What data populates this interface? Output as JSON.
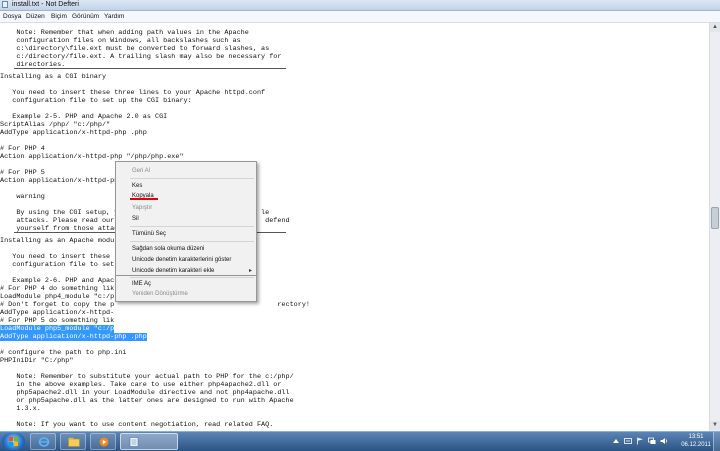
{
  "window": {
    "title": "install.txt - Not Defteri"
  },
  "menu": [
    "Dosya",
    "Düzen",
    "Biçim",
    "Görünüm",
    "Yardım"
  ],
  "document": {
    "lines": [
      "    Note: Remember that when adding path values in the Apache",
      "    configuration files on Windows, all backslashes such as",
      "    c:\\directory\\file.ext must be converted to forward slashes, as",
      "    c:/directory/file.ext. A trailing slash may also be necessary for",
      "    directories.",
      "",
      "Installing as a CGI binary",
      "",
      "   You need to insert these three lines to your Apache httpd.conf",
      "   configuration file to set up the CGI binary:",
      "",
      "   Example 2-5. PHP and Apache 2.0 as CGI",
      "ScriptAlias /php/ \"c:/php/\"",
      "AddType application/x-httpd-php .php",
      "",
      "# For PHP 4",
      "Action application/x-httpd-php \"/php/php.exe\"",
      "",
      "# For PHP 5",
      "Action application/x-httpd-php \"/php/php-cgi.exe\"",
      "",
      "    warning",
      "",
      "    By using the CGI setup, y                                   le",
      "    attacks. Please read our                                     defend",
      "    yourself from those attac",
      "",
      "",
      "Installing as an Apache modu",
      "",
      "   You need to insert these",
      "   configuration file to set",
      "",
      "   Example 2-6. PHP and Apac",
      "# For PHP 4 do something lik",
      "LoadModule php4_module \"c:/p",
      "# Don't forget to copy the p                                        rectory!",
      "AddType application/x-httpd-",
      "",
      "# For PHP 5 do something lik",
      "",
      "",
      "",
      "# configure the path to php.ini",
      "PHPIniDir \"C:/php\"",
      "",
      "    Note: Remember to substitute your actual path to PHP for the c:/php/",
      "    in the above examples. Take care to use either php4apache2.dll or",
      "    php5apache2.dll in your LoadModule directive and not php4apache.dll",
      "    or php5apache.dll as the latter ones are designed to run with Apache",
      "    1.3.x.",
      "",
      "    Note: If you want to use content negotiation, read related FAQ.",
      "",
      "    Warning",
      "",
      "    Don't mix up your installation with DLL files from different PHP",
      "    versions. You have the only choice to use the DLL's and extensions that",
      "    ship with your downloaded PHP version."
    ],
    "selected_lines": [
      "LoadModule php5_module \"c:/p",
      "AddType application/x-httpd-php .php"
    ]
  },
  "context_menu": {
    "items": [
      {
        "label": "Geri Al",
        "enabled": false
      },
      {
        "label": "Kes",
        "enabled": true
      },
      {
        "label": "Kopyala",
        "enabled": true
      },
      {
        "label": "Yapıştır",
        "enabled": false
      },
      {
        "label": "Sil",
        "enabled": true
      },
      {
        "label": "Tümünü Seç",
        "enabled": true
      },
      {
        "label": "Sağdan sola okuma düzeni",
        "enabled": true
      },
      {
        "label": "Unicode denetim karakterlerini göster",
        "enabled": true
      },
      {
        "label": "Unicode denetim karakteri ekle",
        "enabled": true
      },
      {
        "label": "IME Aç",
        "enabled": true
      },
      {
        "label": "Yeniden Dönüştürme",
        "enabled": false
      }
    ]
  },
  "taskbar": {
    "apps": [
      "internet-explorer",
      "windows-explorer",
      "media-player",
      "notepad"
    ],
    "clock": {
      "time": "13:51",
      "date": "06.12.2011"
    }
  },
  "colors": {
    "selection": "#3399ff",
    "taskbar": "#2b5485",
    "annotation": "#e00000"
  }
}
